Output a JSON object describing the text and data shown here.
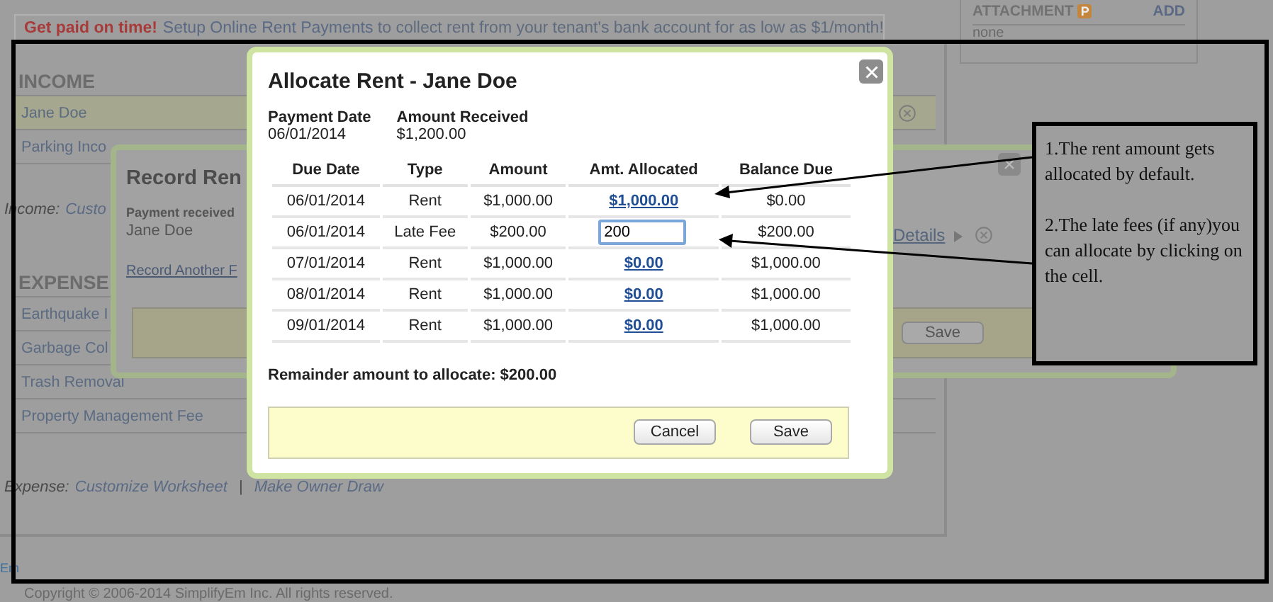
{
  "banner": {
    "title": "Get paid on time!",
    "link": "Setup Online Rent Payments",
    "text": "to collect rent from your tenant's bank account for as low as $1/month!"
  },
  "attachment_panel": {
    "title": "ATTACHMENT",
    "badge": "P",
    "action": "ADD",
    "value": "none"
  },
  "income": {
    "heading": "INCOME",
    "items": [
      {
        "label": "Jane Doe",
        "selected": true
      },
      {
        "label": "Parking Inco",
        "selected": false
      }
    ],
    "footer_label": "Income:",
    "links": [
      "Custo"
    ]
  },
  "expense": {
    "heading": "EXPENSE",
    "items": [
      {
        "label": "Earthquake I",
        "selected": false
      },
      {
        "label": "Garbage Col",
        "selected": false
      },
      {
        "label": "Trash Removal",
        "selected": false
      },
      {
        "label": "Property Management Fee",
        "selected": false
      }
    ],
    "footer_label": "Expense:",
    "links": [
      "Customize Worksheet",
      "Make Owner Draw"
    ],
    "separator": "|"
  },
  "record_dialog": {
    "title": "Record Ren",
    "payment_label": "Payment received",
    "payer": "Jane Doe",
    "link": "Record Another F",
    "details_link": "Details",
    "save": "Save"
  },
  "allocate_dialog": {
    "title": "Allocate Rent - Jane Doe",
    "payment_date_label": "Payment Date",
    "payment_date": "06/01/2014",
    "amount_label": "Amount Received",
    "amount": "$1,200.00",
    "columns": [
      "Due Date",
      "Type",
      "Amount",
      "Amt. Allocated",
      "Balance Due"
    ],
    "rows": [
      {
        "due_date": "06/01/2014",
        "type": "Rent",
        "amount": "$1,000.00",
        "kind": "link",
        "allocated": "$1,000.00",
        "balance": "$0.00"
      },
      {
        "due_date": "06/01/2014",
        "type": "Late Fee",
        "amount": "$200.00",
        "kind": "input",
        "allocated": "200",
        "balance": "$200.00"
      },
      {
        "due_date": "07/01/2014",
        "type": "Rent",
        "amount": "$1,000.00",
        "kind": "link",
        "allocated": "$0.00",
        "balance": "$1,000.00"
      },
      {
        "due_date": "08/01/2014",
        "type": "Rent",
        "amount": "$1,000.00",
        "kind": "link",
        "allocated": "$0.00",
        "balance": "$1,000.00"
      },
      {
        "due_date": "09/01/2014",
        "type": "Rent",
        "amount": "$1,000.00",
        "kind": "link",
        "allocated": "$0.00",
        "balance": "$1,000.00"
      }
    ],
    "remainder": "Remainder amount to allocate: $200.00",
    "buttons": [
      "Cancel",
      "Save"
    ]
  },
  "annotation": {
    "notes": [
      "1.The rent amount gets allocated by default.",
      "2.The late fees (if any)you can allocate by clicking on the cell."
    ]
  },
  "footer": {
    "link": "Em",
    "copyright": "Copyright © 2006-2014 SimplifyEm Inc. All rights reserved."
  }
}
